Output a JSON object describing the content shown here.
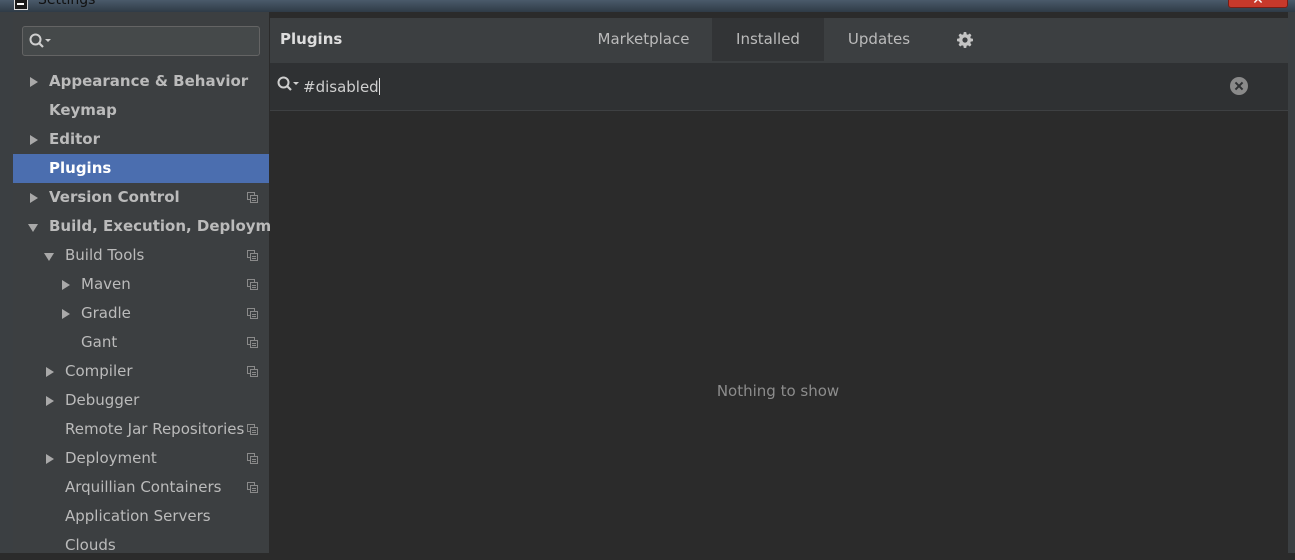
{
  "window": {
    "title": "Settings",
    "close_label": "✕"
  },
  "sidebar": {
    "search": {
      "value": ""
    },
    "items": [
      {
        "label": "Appearance & Behavior",
        "arrow": "right",
        "bold": true,
        "indent": 0,
        "project": false
      },
      {
        "label": "Keymap",
        "arrow": "none",
        "bold": true,
        "indent": 0,
        "project": false
      },
      {
        "label": "Editor",
        "arrow": "right",
        "bold": true,
        "indent": 0,
        "project": false
      },
      {
        "label": "Plugins",
        "arrow": "none",
        "bold": true,
        "indent": 0,
        "project": false,
        "selected": true
      },
      {
        "label": "Version Control",
        "arrow": "right",
        "bold": true,
        "indent": 0,
        "project": true
      },
      {
        "label": "Build, Execution, Deployment",
        "arrow": "down",
        "bold": true,
        "indent": 0,
        "project": false
      },
      {
        "label": "Build Tools",
        "arrow": "down",
        "bold": false,
        "indent": 1,
        "project": true
      },
      {
        "label": "Maven",
        "arrow": "right",
        "bold": false,
        "indent": 2,
        "project": true
      },
      {
        "label": "Gradle",
        "arrow": "right",
        "bold": false,
        "indent": 2,
        "project": true
      },
      {
        "label": "Gant",
        "arrow": "none",
        "bold": false,
        "indent": 2,
        "project": true
      },
      {
        "label": "Compiler",
        "arrow": "right",
        "bold": false,
        "indent": 1,
        "project": true
      },
      {
        "label": "Debugger",
        "arrow": "right",
        "bold": false,
        "indent": 1,
        "project": false
      },
      {
        "label": "Remote Jar Repositories",
        "arrow": "none",
        "bold": false,
        "indent": 1,
        "project": true
      },
      {
        "label": "Deployment",
        "arrow": "right",
        "bold": false,
        "indent": 1,
        "project": true
      },
      {
        "label": "Arquillian Containers",
        "arrow": "none",
        "bold": false,
        "indent": 1,
        "project": true
      },
      {
        "label": "Application Servers",
        "arrow": "none",
        "bold": false,
        "indent": 1,
        "project": false
      },
      {
        "label": "Clouds",
        "arrow": "none",
        "bold": false,
        "indent": 1,
        "project": false
      }
    ]
  },
  "header": {
    "title": "Plugins",
    "tabs": [
      {
        "label": "Marketplace",
        "active": false
      },
      {
        "label": "Installed",
        "active": true
      },
      {
        "label": "Updates",
        "active": false
      }
    ],
    "settings_icon": "gear-icon"
  },
  "plugin_search": {
    "value": "#disabled"
  },
  "empty_state": {
    "text": "Nothing to show"
  },
  "colors": {
    "selection": "#4b6eaf",
    "background": "#2b2b2b",
    "sidebar": "#3c3f41"
  }
}
